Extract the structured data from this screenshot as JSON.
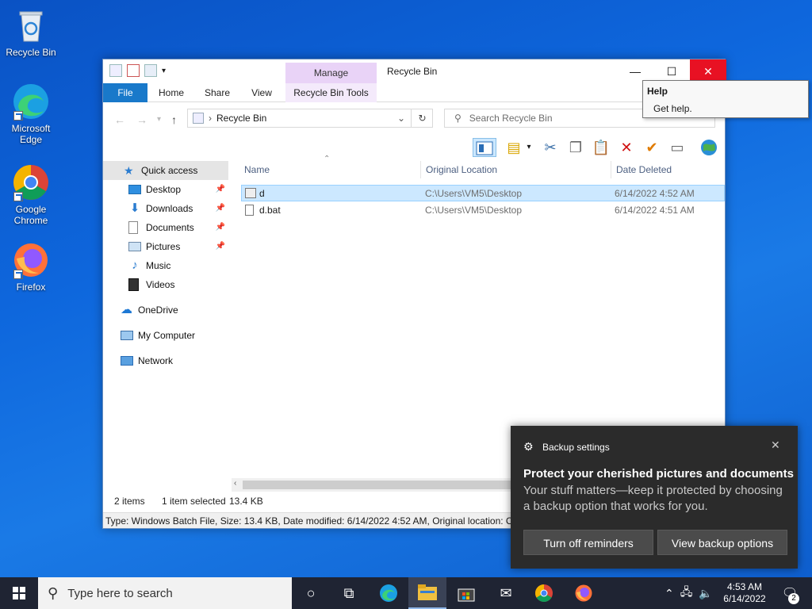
{
  "desktop": {
    "icons": [
      {
        "label": "Recycle Bin"
      },
      {
        "label": "Microsoft Edge"
      },
      {
        "label": "Google Chrome"
      },
      {
        "label": "Firefox"
      }
    ]
  },
  "window": {
    "title": "Recycle Bin",
    "manage_tab": "Manage",
    "ribbon_tabs": [
      "File",
      "Home",
      "Share",
      "View",
      "Recycle Bin Tools"
    ],
    "address": "Recycle Bin",
    "search_placeholder": "Search Recycle Bin",
    "nav": {
      "quick_access": "Quick access",
      "items": [
        "Desktop",
        "Downloads",
        "Documents",
        "Pictures",
        "Music",
        "Videos"
      ],
      "onedrive": "OneDrive",
      "my_computer": "My Computer",
      "network": "Network"
    },
    "columns": [
      "Name",
      "Original Location",
      "Date Deleted"
    ],
    "files": [
      {
        "name": "d",
        "location": "C:\\Users\\VM5\\Desktop",
        "date": "6/14/2022 4:52 AM"
      },
      {
        "name": "d.bat",
        "location": "C:\\Users\\VM5\\Desktop",
        "date": "6/14/2022 4:51 AM"
      }
    ],
    "status": {
      "count": "2 items",
      "selected": "1 item selected",
      "size": "13.4 KB"
    },
    "details": "Type: Windows Batch File, Size: 13.4 KB, Date modified: 6/14/2022 4:52 AM, Original location: C:\\U"
  },
  "help_tip": {
    "title": "Help",
    "text": "Get help."
  },
  "toast": {
    "app": "Backup settings",
    "title": "Protect your cherished pictures and documents",
    "body": "Your stuff matters—keep it protected by choosing a backup option that works for you.",
    "btn_off": "Turn off reminders",
    "btn_view": "View backup options"
  },
  "taskbar": {
    "search_placeholder": "Type here to search",
    "time": "4:53 AM",
    "date": "6/14/2022",
    "notif_count": "2"
  },
  "colors": {
    "accent": "#1979ca",
    "close_red": "#e81123",
    "selection": "#cce8ff"
  }
}
